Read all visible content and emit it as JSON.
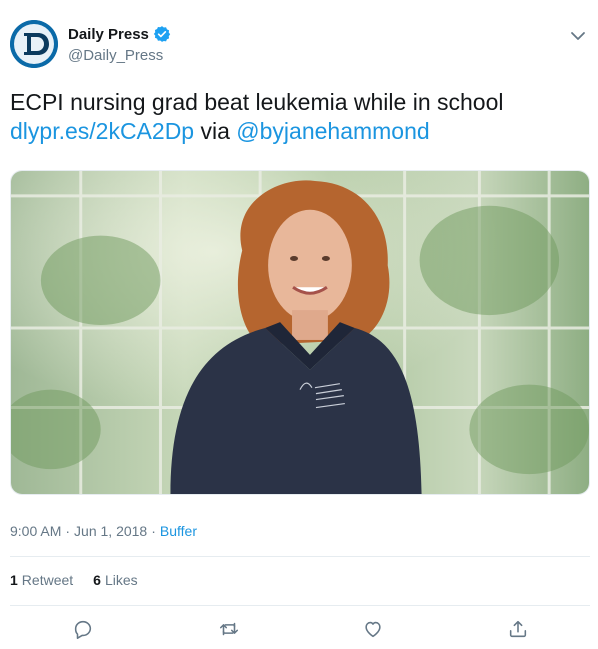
{
  "tweet": {
    "author": {
      "display_name": "Daily Press",
      "handle": "@Daily_Press",
      "verified": true,
      "avatar_icon": "daily-press-logo",
      "avatar_bg": "#0b6aa8"
    },
    "text_line1": "ECPI nursing grad beat leukemia while in school",
    "link_text": "dlypr.es/2kCA2Dp",
    "via_text": " via ",
    "mention": "@byjanehammond",
    "media": {
      "description_icon": "photo"
    },
    "time": "9:00 AM",
    "date": "Jun 1, 2018",
    "source": "Buffer",
    "separator": "·",
    "retweets_count": "1",
    "retweets_label": "Retweet",
    "likes_count": "6",
    "likes_label": "Likes"
  },
  "actions": {
    "reply_icon": "reply-icon",
    "retweet_icon": "retweet-icon",
    "like_icon": "heart-icon",
    "share_icon": "share-icon"
  },
  "colors": {
    "link": "#1b95e0",
    "muted": "#657786",
    "text": "#14171a",
    "border": "#e6ecf0",
    "verified": "#1da1f2"
  }
}
